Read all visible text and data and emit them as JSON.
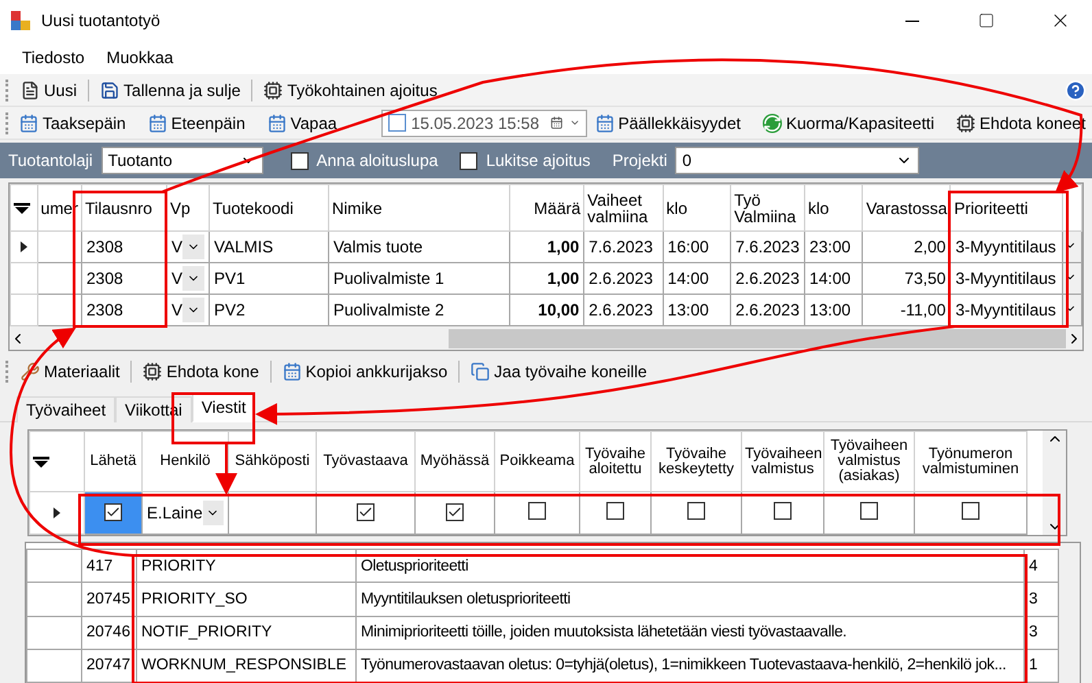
{
  "window": {
    "title": "Uusi tuotantotyö"
  },
  "menu": [
    "Tiedosto",
    "Muokkaa"
  ],
  "toolbar_1": [
    {
      "kind": "new",
      "label": "Uusi"
    },
    {
      "kind": "save",
      "label": "Tallenna ja sulje"
    },
    {
      "kind": "schedule",
      "label": "Työkohtainen ajoitus"
    }
  ],
  "toolbar_2": [
    {
      "kind": "calendar",
      "label": "Taaksepäin"
    },
    {
      "kind": "calendar",
      "label": "Eteenpäin"
    },
    {
      "kind": "calendar",
      "label": "Vapaa"
    },
    {
      "kind": "date",
      "label": "15.05.2023 15:58",
      "checked": false
    },
    {
      "kind": "calendar",
      "label": "Päällekkäisyydet"
    },
    {
      "kind": "refresh",
      "label": "Kuorma/Kapasiteetti"
    },
    {
      "kind": "schedule",
      "label": "Ehdota koneet"
    }
  ],
  "filter_bar": {
    "type_label": "Tuotantolaji",
    "type_value": "Tuotanto",
    "start_permit": {
      "label": "Anna aloituslupa",
      "checked": false
    },
    "lock": {
      "label": "Lukitse ajoitus",
      "checked": false
    },
    "project_label": "Projekti",
    "project_value": "0"
  },
  "work_grid": {
    "columns": [
      "umer",
      "Tilausnro",
      "Vp",
      "Tuotekoodi",
      "Nimike",
      "Määrä",
      "Vaiheet valmiina",
      "klo",
      "Työ Valmiina",
      "klo",
      "Varastossa",
      "Prioriteetti"
    ],
    "rows": [
      {
        "current": true,
        "cells": [
          "",
          "2308",
          "V",
          "VALMIS",
          "Valmis tuote",
          "1,00",
          "7.6.2023",
          "16:00",
          "7.6.2023",
          "23:00",
          "2,00",
          "3-Myyntitilaus"
        ]
      },
      {
        "current": false,
        "cells": [
          "",
          "2308",
          "V",
          "PV1",
          "Puolivalmiste 1",
          "1,00",
          "2.6.2023",
          "14:00",
          "2.6.2023",
          "14:00",
          "73,50",
          "3-Myyntitilaus"
        ]
      },
      {
        "current": false,
        "cells": [
          "",
          "2308",
          "V",
          "PV2",
          "Puolivalmiste 2",
          "10,00",
          "2.6.2023",
          "13:00",
          "2.6.2023",
          "13:00",
          "-11,00",
          "3-Myyntitilaus"
        ]
      }
    ]
  },
  "toolbar_3": [
    {
      "kind": "materials",
      "label": "Materiaalit"
    },
    {
      "kind": "schedule",
      "label": "Ehdota kone"
    },
    {
      "kind": "calendar",
      "label": "Kopioi ankkurijakso"
    },
    {
      "kind": "split",
      "label": "Jaa työvaihe koneille"
    }
  ],
  "tabs": [
    {
      "label": "Työvaiheet",
      "selected": false
    },
    {
      "label": "Viikottai",
      "selected": false
    },
    {
      "label": "Viestit",
      "selected": true
    }
  ],
  "messages_grid": {
    "columns": [
      "Lähetä",
      "Henkilö",
      "Sähköposti",
      "Työvastaava",
      "Myöhässä",
      "Poikkeama",
      "Työvaihe aloitettu",
      "Työvaihe keskeytetty",
      "Työvaiheen valmistus",
      "Työvaiheen valmistus (asiakas)",
      "Työnumeron valmistuminen"
    ],
    "rows": [
      {
        "current": true,
        "cells": [
          {
            "kind": "check",
            "checked": true,
            "selected": true
          },
          {
            "kind": "combo",
            "value": "E.Laine",
            "selected": false
          },
          {
            "kind": "blank",
            "selected": false
          },
          {
            "kind": "check",
            "checked": true,
            "selected": false
          },
          {
            "kind": "check",
            "checked": true,
            "selected": false
          },
          {
            "kind": "check",
            "checked": false,
            "selected": false
          },
          {
            "kind": "check",
            "checked": false,
            "selected": false
          },
          {
            "kind": "check",
            "checked": false,
            "selected": false
          },
          {
            "kind": "check",
            "checked": false,
            "selected": false
          },
          {
            "kind": "check",
            "checked": false,
            "selected": false
          },
          {
            "kind": "check",
            "checked": false,
            "selected": false
          }
        ]
      }
    ]
  },
  "settings_grid": {
    "rows": [
      {
        "id": "417",
        "name": "PRIORITY",
        "description": "Oletusprioriteetti",
        "value": "4"
      },
      {
        "id": "20745",
        "name": "PRIORITY_SO",
        "description": "Myyntitilauksen oletusprioriteetti",
        "value": "3"
      },
      {
        "id": "20746",
        "name": "NOTIF_PRIORITY",
        "description": "Minimiprioriteetti töille, joiden muutoksista lähetetään viesti työvastaavalle.",
        "value": "3"
      },
      {
        "id": "20747",
        "name": "WORKNUM_RESPONSIBLE",
        "description": "Työnumerovastaavan oletus: 0=tyhjä(oletus), 1=nimikkeen Tuotevastaava-henkilö, 2=henkilö jok...",
        "value": "1"
      }
    ]
  }
}
